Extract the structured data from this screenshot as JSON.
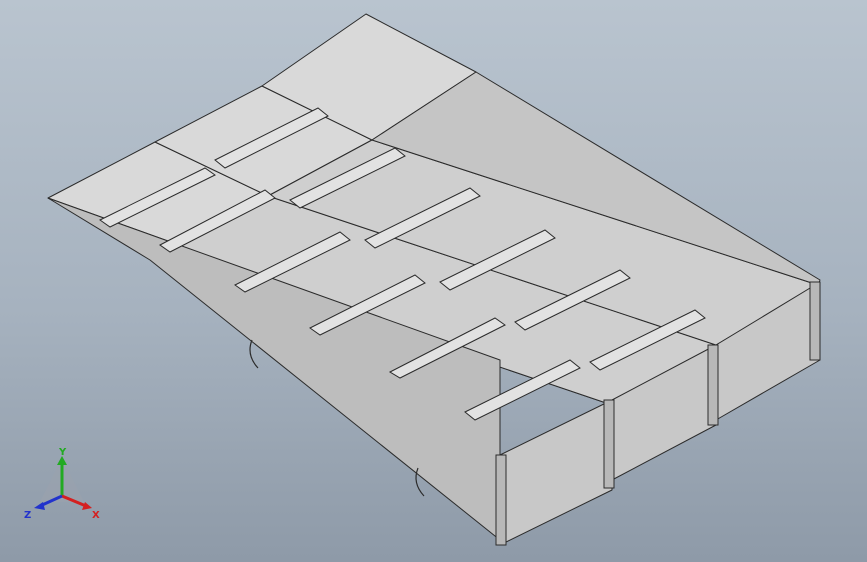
{
  "viewport": {
    "background_top": "#b9c4cf",
    "background_bottom": "#8e9aa8",
    "model_fill": "#d4d4d4",
    "model_edge": "#2b2b2b"
  },
  "triad": {
    "x_label": "X",
    "y_label": "Y",
    "z_label": "Z",
    "x_color": "#d42020",
    "y_color": "#22aa22",
    "z_color": "#2233cc"
  }
}
